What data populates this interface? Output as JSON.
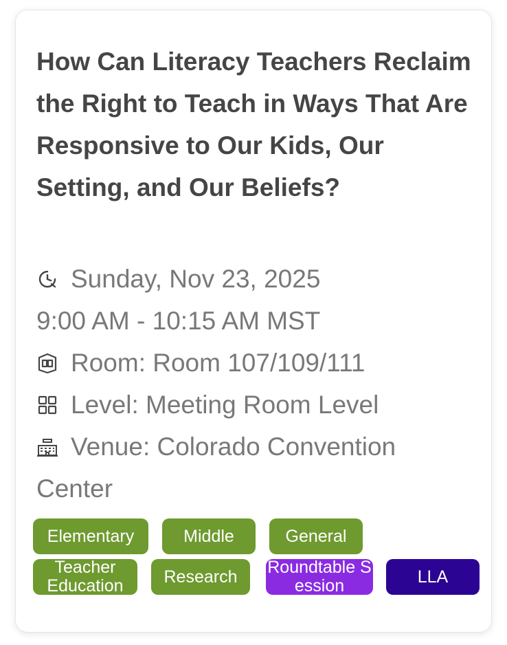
{
  "session": {
    "title": "How Can Literacy Teachers Reclaim the Right to Teach in Ways That Are Responsive to Our Kids, Our Setting, and Our Beliefs?",
    "date": "Sunday, Nov 23, 2025",
    "time": "9:00 AM - 10:15 AM MST",
    "room": "Room: Room 107/109/111",
    "level": "Level: Meeting Room Level",
    "venue_line1": "Venue: Colorado Convention",
    "venue_line2": "Center"
  },
  "icons": {
    "clock": "clock-icon",
    "room": "room-icon",
    "level": "grid-icon",
    "venue": "building-icon"
  },
  "tags": [
    {
      "label": "Elementary",
      "color": "#6e9a2f"
    },
    {
      "label": "Middle",
      "color": "#6e9a2f"
    },
    {
      "label": "General",
      "color": "#6e9a2f"
    },
    {
      "label": "Teacher Education",
      "color": "#6e9a2f"
    },
    {
      "label": "Research",
      "color": "#6e9a2f"
    },
    {
      "label": "Roundtable Session",
      "color": "#8a2be2"
    },
    {
      "label": "LLA",
      "color": "#2c0494"
    }
  ]
}
